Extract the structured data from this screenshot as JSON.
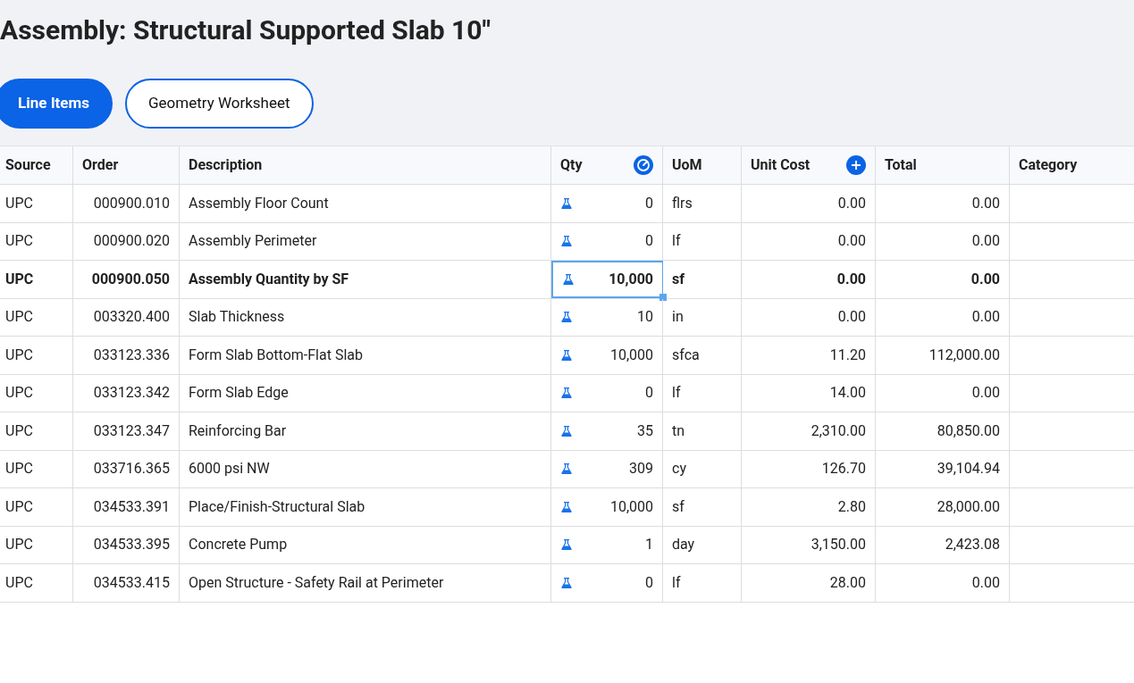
{
  "title": "Assembly: Structural Supported Slab 10\"",
  "tabs": [
    {
      "label": "Line Items",
      "selected": true
    },
    {
      "label": "Geometry Worksheet",
      "selected": false
    }
  ],
  "table": {
    "columns": [
      "Source",
      "Order",
      "Description",
      "Qty",
      "UoM",
      "Unit Cost",
      "Total",
      "Category"
    ],
    "rows": [
      {
        "source": "UPC",
        "order": "000900.010",
        "description": "Assembly Floor Count",
        "qty": "0",
        "uom": "flrs",
        "unit_cost": "0.00",
        "total": "0.00",
        "emphasized": false,
        "focused": false
      },
      {
        "source": "UPC",
        "order": "000900.020",
        "description": "Assembly Perimeter",
        "qty": "0",
        "uom": "lf",
        "unit_cost": "0.00",
        "total": "0.00",
        "emphasized": false,
        "focused": false
      },
      {
        "source": "UPC",
        "order": "000900.050",
        "description": "Assembly Quantity by SF",
        "qty": "10,000",
        "uom": "sf",
        "unit_cost": "0.00",
        "total": "0.00",
        "emphasized": true,
        "focused": true
      },
      {
        "source": "UPC",
        "order": "003320.400",
        "description": "Slab Thickness",
        "qty": "10",
        "uom": "in",
        "unit_cost": "0.00",
        "total": "0.00",
        "emphasized": false,
        "focused": false
      },
      {
        "source": "UPC",
        "order": "033123.336",
        "description": "Form Slab Bottom-Flat Slab",
        "qty": "10,000",
        "uom": "sfca",
        "unit_cost": "11.20",
        "total": "112,000.00",
        "emphasized": false,
        "focused": false
      },
      {
        "source": "UPC",
        "order": "033123.342",
        "description": "Form Slab Edge",
        "qty": "0",
        "uom": "lf",
        "unit_cost": "14.00",
        "total": "0.00",
        "emphasized": false,
        "focused": false
      },
      {
        "source": "UPC",
        "order": "033123.347",
        "description": "Reinforcing Bar",
        "qty": "35",
        "uom": "tn",
        "unit_cost": "2,310.00",
        "total": "80,850.00",
        "emphasized": false,
        "focused": false
      },
      {
        "source": "UPC",
        "order": "033716.365",
        "description": "6000 psi NW",
        "qty": "309",
        "uom": "cy",
        "unit_cost": "126.70",
        "total": "39,104.94",
        "emphasized": false,
        "focused": false
      },
      {
        "source": "UPC",
        "order": "034533.391",
        "description": "Place/Finish-Structural Slab",
        "qty": "10,000",
        "uom": "sf",
        "unit_cost": "2.80",
        "total": "28,000.00",
        "emphasized": false,
        "focused": false
      },
      {
        "source": "UPC",
        "order": "034533.395",
        "description": "Concrete Pump",
        "qty": "1",
        "uom": "day",
        "unit_cost": "3,150.00",
        "total": "2,423.08",
        "emphasized": false,
        "focused": false
      },
      {
        "source": "UPC",
        "order": "034533.415",
        "description": "Open Structure - Safety Rail at Perimeter",
        "qty": "0",
        "uom": "lf",
        "unit_cost": "28.00",
        "total": "0.00",
        "emphasized": false,
        "focused": false
      }
    ]
  }
}
